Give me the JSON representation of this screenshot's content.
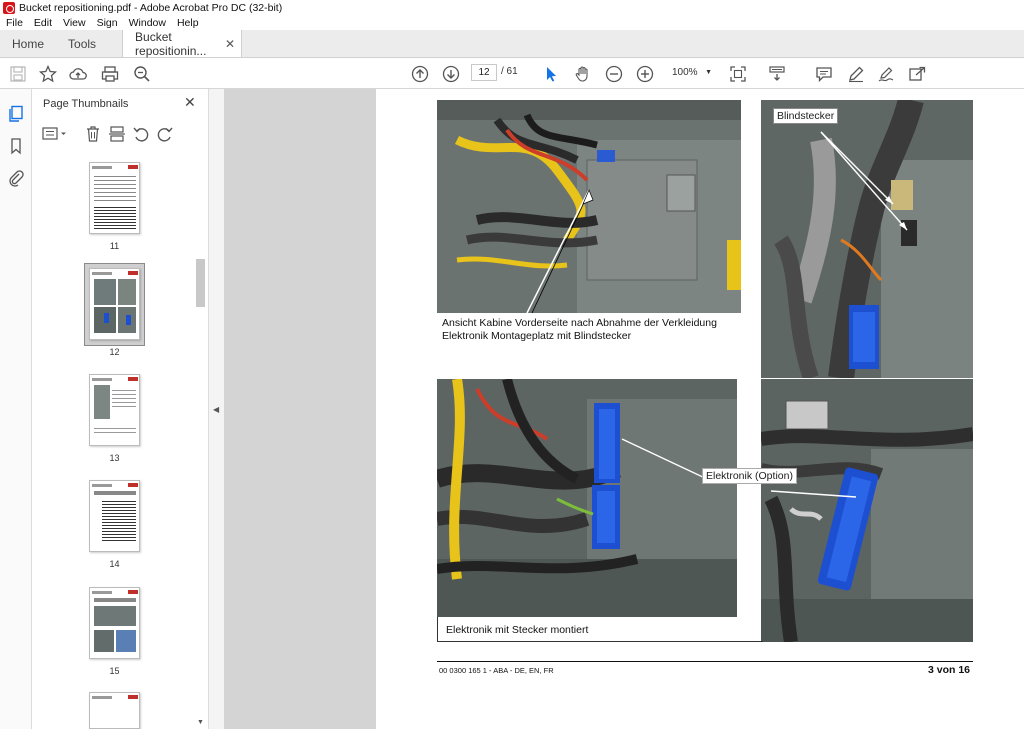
{
  "window": {
    "title": "Bucket repositioning.pdf - Adobe Acrobat Pro DC (32-bit)"
  },
  "menu": {
    "items": [
      "File",
      "Edit",
      "View",
      "Sign",
      "Window",
      "Help"
    ]
  },
  "tabs": {
    "home": "Home",
    "tools": "Tools",
    "document": "Bucket repositionin...",
    "close": "✕"
  },
  "toolbar": {
    "page_current": "12",
    "page_total": "/ 61",
    "zoom": "100%",
    "icons": [
      "save-icon",
      "bookmark-star-icon",
      "upload-cloud-icon",
      "print-icon",
      "search-zoom-icon",
      "prev-page-icon",
      "next-page-icon",
      "select-cursor-icon",
      "hand-icon",
      "zoom-out-icon",
      "zoom-in-icon",
      "fit-page-icon",
      "scroll-mode-icon",
      "comment-icon",
      "highlight-pen-icon",
      "sign-icon",
      "share-icon"
    ]
  },
  "panel": {
    "title": "Page Thumbnails",
    "close": "✕",
    "thumbnails": [
      {
        "num": "11"
      },
      {
        "num": "12",
        "selected": true
      },
      {
        "num": "13"
      },
      {
        "num": "14"
      },
      {
        "num": "15"
      }
    ]
  },
  "document": {
    "caption_top_1": "Ansicht Kabine Vorderseite nach Abnahme der Verkleidung",
    "caption_top_2": "Elektronik Montageplatz mit Blindstecker",
    "callout_blindstecker": "Blindstecker",
    "callout_elektronik": "Elektronik (Option)",
    "caption_bottom": "Elektronik mit Stecker montiert",
    "footer_left": "00 0300 165 1 - ABA - DE, EN, FR",
    "footer_right": "3 von 16"
  },
  "colors": {
    "accent": "#1473e6",
    "brand": "#d7141a",
    "electronic_box": "#1d4fd1",
    "cable_yellow": "#e8c31a"
  }
}
